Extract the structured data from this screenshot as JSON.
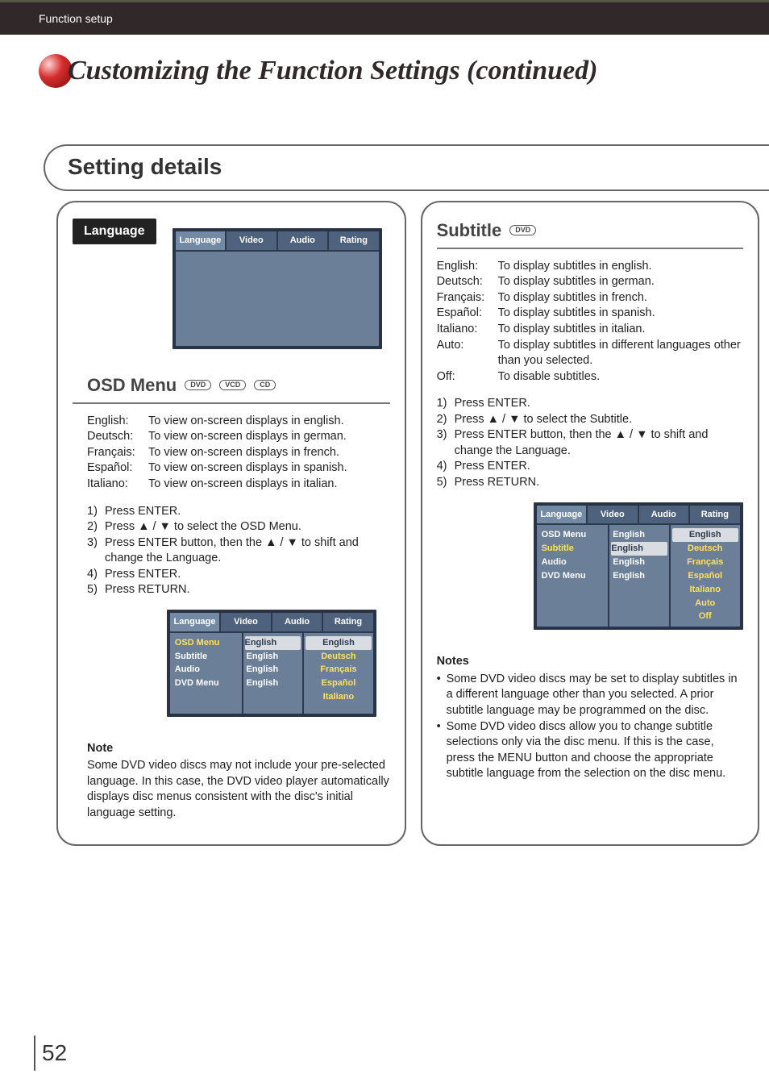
{
  "header": {
    "section": "Function setup",
    "title": "Customizing the Function Settings (continued)"
  },
  "setting_details_label": "Setting details",
  "left": {
    "language_chip": "Language",
    "osd_menu": {
      "heading": "OSD Menu",
      "discs": [
        "DVD",
        "VCD",
        "CD"
      ],
      "defs": [
        {
          "k": "English:",
          "v": "To view on-screen displays in english."
        },
        {
          "k": "Deutsch:",
          "v": "To view on-screen displays in german."
        },
        {
          "k": "Français:",
          "v": "To view on-screen displays in french."
        },
        {
          "k": "Español:",
          "v": "To view on-screen displays in spanish."
        },
        {
          "k": "Italiano:",
          "v": "To view on-screen displays in italian."
        }
      ],
      "steps": [
        {
          "n": "1)",
          "t": "Press ENTER."
        },
        {
          "n": "2)",
          "t": "Press ▲ / ▼ to select the OSD Menu."
        },
        {
          "n": "3)",
          "t": "Press ENTER button, then the ▲ / ▼ to shift and change the Language."
        },
        {
          "n": "4)",
          "t": "Press ENTER."
        },
        {
          "n": "5)",
          "t": "Press RETURN."
        }
      ],
      "note_h": "Note",
      "note_p": "Some DVD video discs may not include your pre-selected language. In this case, the DVD video player automatically displays disc menus consistent with the disc's initial language setting."
    },
    "osd_screen_top": {
      "tabs": [
        "Language",
        "Video",
        "Audio",
        "Rating"
      ]
    },
    "osd_screen_bottom": {
      "tabs": [
        "Language",
        "Video",
        "Audio",
        "Rating"
      ],
      "list": [
        "OSD Menu",
        "Subtitle",
        "Audio",
        "DVD Menu"
      ],
      "vals": [
        "English",
        "English",
        "English",
        "English"
      ],
      "opts": [
        "English",
        "Deutsch",
        "Français",
        "Español",
        "Italiano"
      ]
    }
  },
  "right": {
    "subtitle": {
      "heading": "Subtitle",
      "discs": [
        "DVD"
      ],
      "defs": [
        {
          "k": "English:",
          "v": "To display subtitles in english."
        },
        {
          "k": "Deutsch:",
          "v": "To display subtitles in german."
        },
        {
          "k": "Français:",
          "v": "To display subtitles in french."
        },
        {
          "k": "Español:",
          "v": "To display subtitles in spanish."
        },
        {
          "k": "Italiano:",
          "v": "To display subtitles in italian."
        },
        {
          "k": "Auto:",
          "v": "To display subtitles in different languages other than you selected."
        },
        {
          "k": "Off:",
          "v": "To disable subtitles."
        }
      ],
      "steps": [
        {
          "n": "1)",
          "t": "Press ENTER."
        },
        {
          "n": "2)",
          "t": "Press ▲ / ▼ to select the Subtitle."
        },
        {
          "n": "3)",
          "t": "Press ENTER button, then the ▲ / ▼ to shift and change the Language."
        },
        {
          "n": "4)",
          "t": "Press ENTER."
        },
        {
          "n": "5)",
          "t": "Press RETURN."
        }
      ],
      "notes_h": "Notes",
      "notes": [
        "Some DVD video discs may be set to display subtitles in a different language other than you selected. A prior subtitle language may be programmed on the disc.",
        "Some DVD video discs allow you to change subtitle selections only via the disc menu. If this is the case, press the MENU button and choose the appropriate subtitle language from the selection on the disc menu."
      ]
    },
    "osd_screen": {
      "tabs": [
        "Language",
        "Video",
        "Audio",
        "Rating"
      ],
      "list": [
        "OSD Menu",
        "Subtitle",
        "Audio",
        "DVD Menu"
      ],
      "vals": [
        "English",
        "English",
        "English",
        "English"
      ],
      "opts": [
        "English",
        "Deutsch",
        "Français",
        "Español",
        "Italiano",
        "Auto",
        "Off"
      ]
    }
  },
  "page_number": "52"
}
